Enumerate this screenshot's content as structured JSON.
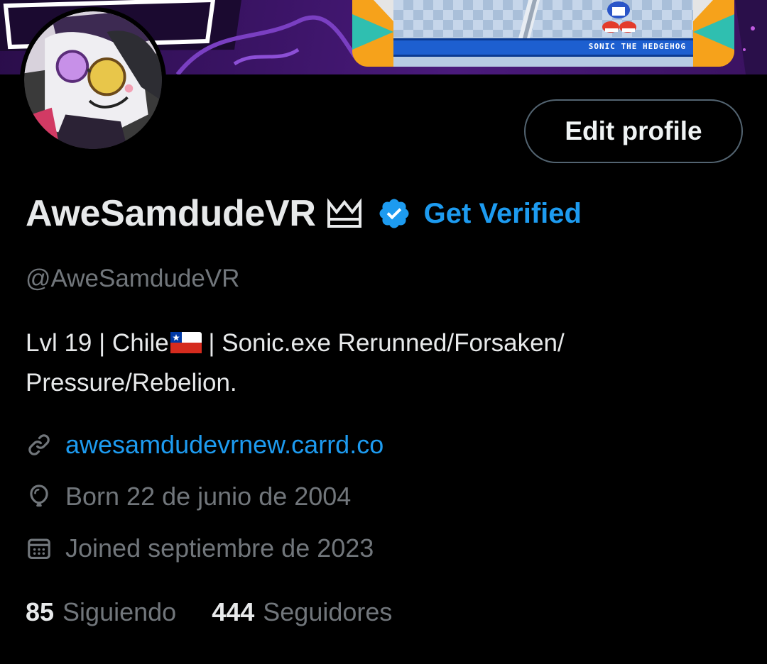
{
  "banner": {
    "card_title": "SONIC THE HEDGEHOG"
  },
  "profile": {
    "edit_button_label": "Edit profile",
    "display_name": "AweSamdudeVR",
    "get_verified_label": "Get Verified",
    "handle": "@AweSamdudeVR",
    "bio_part1": "Lvl 19 | Chile",
    "bio_part2": " | Sonic.exe Rerunned/Forsaken/ Pressure/Rebelion.",
    "link": "awesamdudevrnew.carrd.co",
    "born": "Born 22 de junio de 2004",
    "joined": "Joined septiembre de 2023",
    "following_count": "85",
    "following_label": "Siguiendo",
    "followers_count": "444",
    "followers_label": "Seguidores"
  },
  "icons": {
    "name_badge": "crown-icon",
    "verified": "verified-badge-icon",
    "link": "link-icon",
    "birthday": "balloon-icon",
    "joined": "calendar-icon",
    "flag": "chile-flag-icon"
  },
  "colors": {
    "accent": "#1d9bf0",
    "muted": "#71767b",
    "text": "#e7e9ea",
    "background": "#000000"
  }
}
